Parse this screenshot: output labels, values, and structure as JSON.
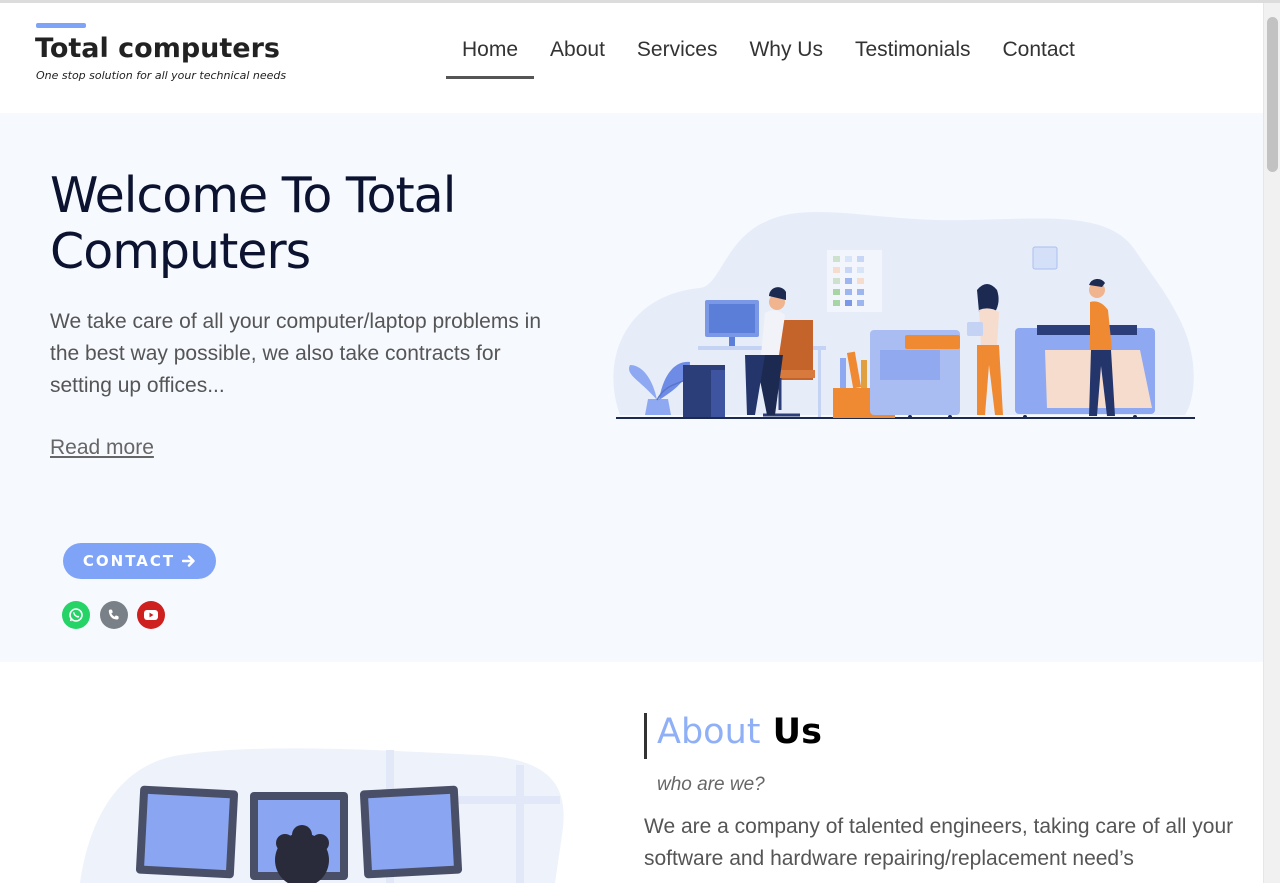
{
  "header": {
    "logo_title": "Total computers",
    "logo_subtitle": "One stop solution for all your technical needs",
    "nav": [
      {
        "label": "Home",
        "active": true
      },
      {
        "label": "About"
      },
      {
        "label": "Services"
      },
      {
        "label": "Why Us"
      },
      {
        "label": "Testimonials"
      },
      {
        "label": "Contact"
      }
    ]
  },
  "hero": {
    "title": "Welcome To Total Computers",
    "text": "We take care of all your computer/laptop problems in the best way possible, we  also take contracts for setting up offices...",
    "read_more": "Read more",
    "contact_button": "CONTACT",
    "contact_icon": "arrow-right-icon",
    "social": [
      {
        "name": "whatsapp-icon",
        "color": "#25d366"
      },
      {
        "name": "phone-icon",
        "color": "#7a8087"
      },
      {
        "name": "youtube-icon",
        "color": "#cd201f"
      }
    ]
  },
  "about": {
    "title_part1": "About",
    "title_part2": "Us",
    "subtitle": "who are we?",
    "text": "We are a company of talented engineers, taking care of all your software and hardware repairing/replacement need’s"
  },
  "colors": {
    "accent": "#7ea3f7",
    "hero_bg": "#f6f9fe",
    "title_dark": "#0b1330"
  }
}
